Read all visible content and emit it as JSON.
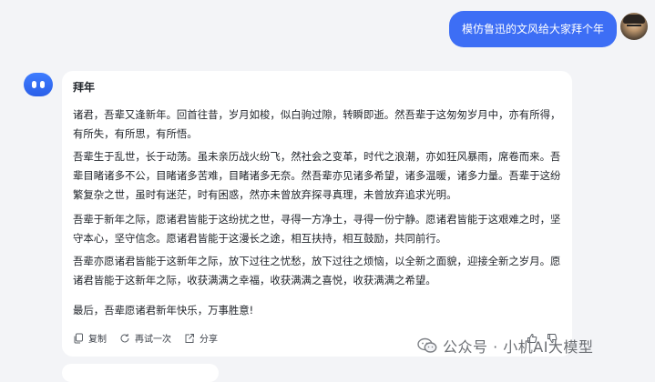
{
  "user": {
    "message": "模仿鲁迅的文风给大家拜个年"
  },
  "bot": {
    "title": "拜年",
    "paragraphs": [
      "诸君，吾辈又逢新年。回首往昔，岁月如梭，似白驹过隙，转瞬即逝。然吾辈于这匆匆岁月中，亦有所得，有所失，有所思，有所悟。",
      "吾辈生于乱世，长于动荡。虽未亲历战火纷飞，然社会之变革，时代之浪潮，亦如狂风暴雨，席卷而来。吾辈目睹诸多不公，目睹诸多苦难，目睹诸多无奈。然吾辈亦见诸多希望，诸多温暖，诸多力量。吾辈于这纷繁复杂之世，虽时有迷茫，时有困惑，然亦未曾放弃探寻真理，未曾放弃追求光明。",
      "吾辈于新年之际，愿诸君皆能于这纷扰之世，寻得一方净土，寻得一份宁静。愿诸君皆能于这艰难之时，坚守本心，坚守信念。愿诸君皆能于这漫长之途，相互扶持，相互鼓励，共同前行。",
      "吾辈亦愿诸君皆能于这新年之际，放下过往之忧愁，放下过往之烦恼，以全新之面貌，迎接全新之岁月。愿诸君皆能于这新年之际，收获满满之幸福，收获满满之喜悦，收获满满之希望。",
      "最后，吾辈愿诸君新年快乐，万事胜意!"
    ],
    "actions": {
      "copy": "复制",
      "retry": "再试一次",
      "share": "分享"
    }
  },
  "watermark": {
    "text": "公众号 · 小机AI大模型"
  },
  "icons": [
    "copy-icon",
    "retry-icon",
    "share-icon",
    "thumb-up-icon",
    "thumb-down-icon",
    "wechat-icon"
  ],
  "colors": {
    "accent": "#3d6ef5",
    "background": "#f3f4f7",
    "card": "#ffffff"
  }
}
